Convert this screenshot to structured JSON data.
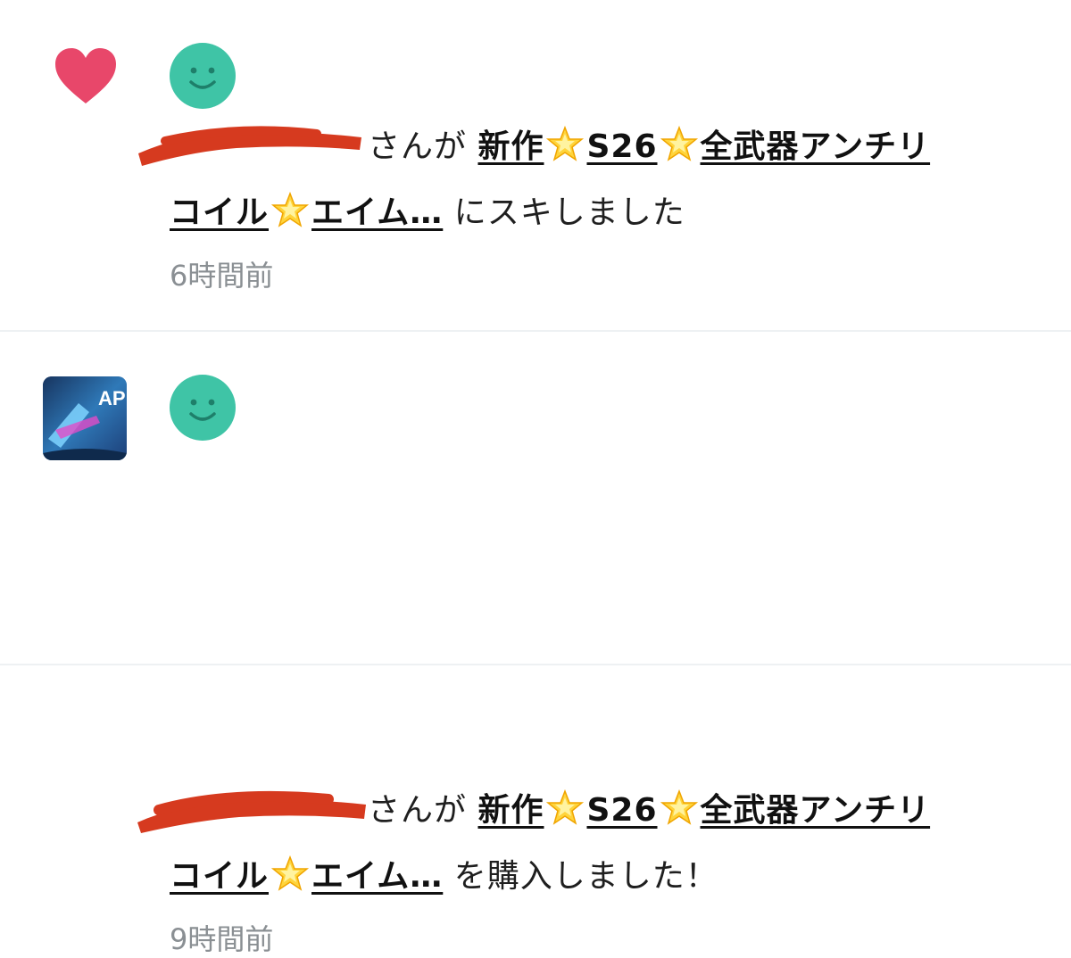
{
  "notifications": [
    {
      "type": "like",
      "suffix_before": "さんが",
      "article_line1": "新作",
      "article_s": "S26",
      "article_part3": "全武器アンチリ",
      "article_line2a": "コイル",
      "article_line2b": "エイム…",
      "action": "にスキしました",
      "time": "6時間前"
    },
    {
      "type": "purchase",
      "suffix_before": "さんが",
      "article_line1": "新作",
      "article_s": "S26",
      "article_part3": "全武器アンチリ",
      "article_line2a": "コイル",
      "article_line2b": "エイム…",
      "action": "を購入しました！",
      "time": "9時間前",
      "thumbnail_text": "AP"
    }
  ],
  "colors": {
    "heart": "#e8476a",
    "avatar": "#3fc4a6",
    "redaction": "#d63a1f",
    "divider": "#eef1f3"
  }
}
